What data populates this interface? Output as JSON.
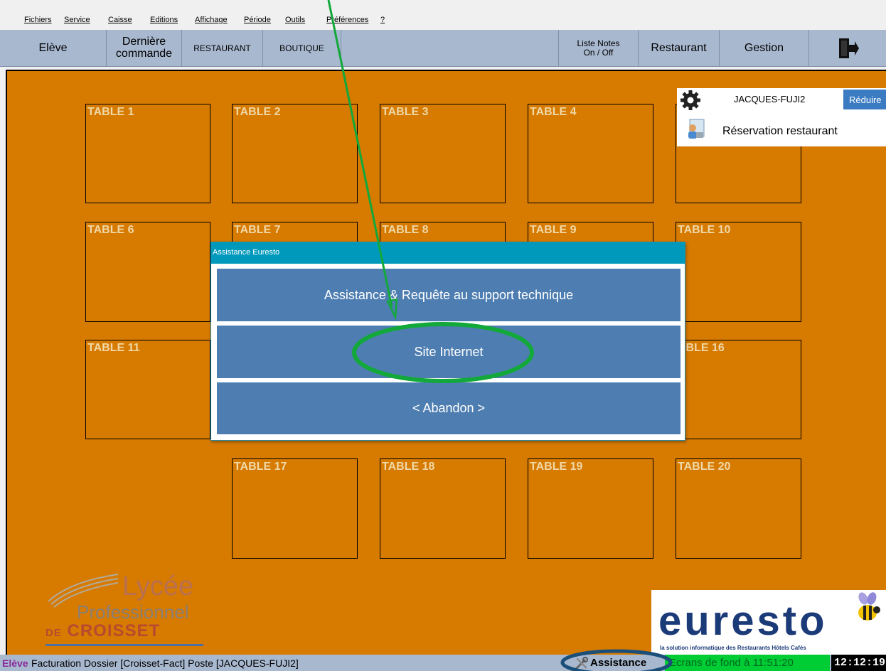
{
  "menu": {
    "items": [
      "Fichiers",
      "Service",
      "Caisse",
      "Editions",
      "Affichage",
      "Période",
      "Outils",
      "Préférences",
      "?"
    ]
  },
  "toolbar": {
    "eleve": "Elève",
    "derniere_line1": "Dernière",
    "derniere_line2": "commande",
    "restaurant_tab": "RESTAURANT",
    "boutique_tab": "BOUTIQUE",
    "liste_notes_line1": "Liste Notes",
    "liste_notes_line2": "On / Off",
    "restaurant": "Restaurant",
    "gestion": "Gestion",
    "exit_icon": "exit-door-icon"
  },
  "tables": [
    "TABLE 1",
    "TABLE 2",
    "TABLE 3",
    "TABLE 4",
    "TABLE 6",
    "TABLE 7",
    "TABLE 8",
    "TABLE 9",
    "TABLE 10",
    "TABLE 11",
    "ABLE 16",
    "TABLE 17",
    "TABLE 18",
    "TABLE 19",
    "TABLE 20"
  ],
  "info_panel": {
    "host": "JACQUES-FUJI2",
    "reduce": "Réduire",
    "reservation": "Réservation restaurant",
    "gear_icon": "gear-icon",
    "reservation_icon": "reservation-icon"
  },
  "dialog": {
    "title": "Assistance Euresto",
    "buttons": [
      "Assistance & Requête au support technique",
      "Site Internet",
      "< Abandon >"
    ]
  },
  "logos": {
    "lycee_line1": "Lycée",
    "lycee_line2": "Professionnel",
    "lycee_de": "DE",
    "lycee_line3": "CROISSET",
    "euresto_word": "euresto",
    "euresto_tagline": "la solution informatique des Restaurants Hôtels Cafés"
  },
  "statusbar": {
    "role": "Elève",
    "document": "Facturation Dossier [Croisset-Fact] Poste [JACQUES-FUJI2]",
    "assistance": "Assistance",
    "screensaver": "Ecrans de fond à 11:51:20",
    "clock": "12:12:19"
  },
  "colors": {
    "main_background": "#d67a00",
    "toolbar": "#a8b8cf",
    "dialog_button": "#4e7eb1",
    "dialog_title_bar": "#0099bb",
    "annotation_green": "#12a83a",
    "annotation_dark_blue": "#1b4f7a"
  }
}
